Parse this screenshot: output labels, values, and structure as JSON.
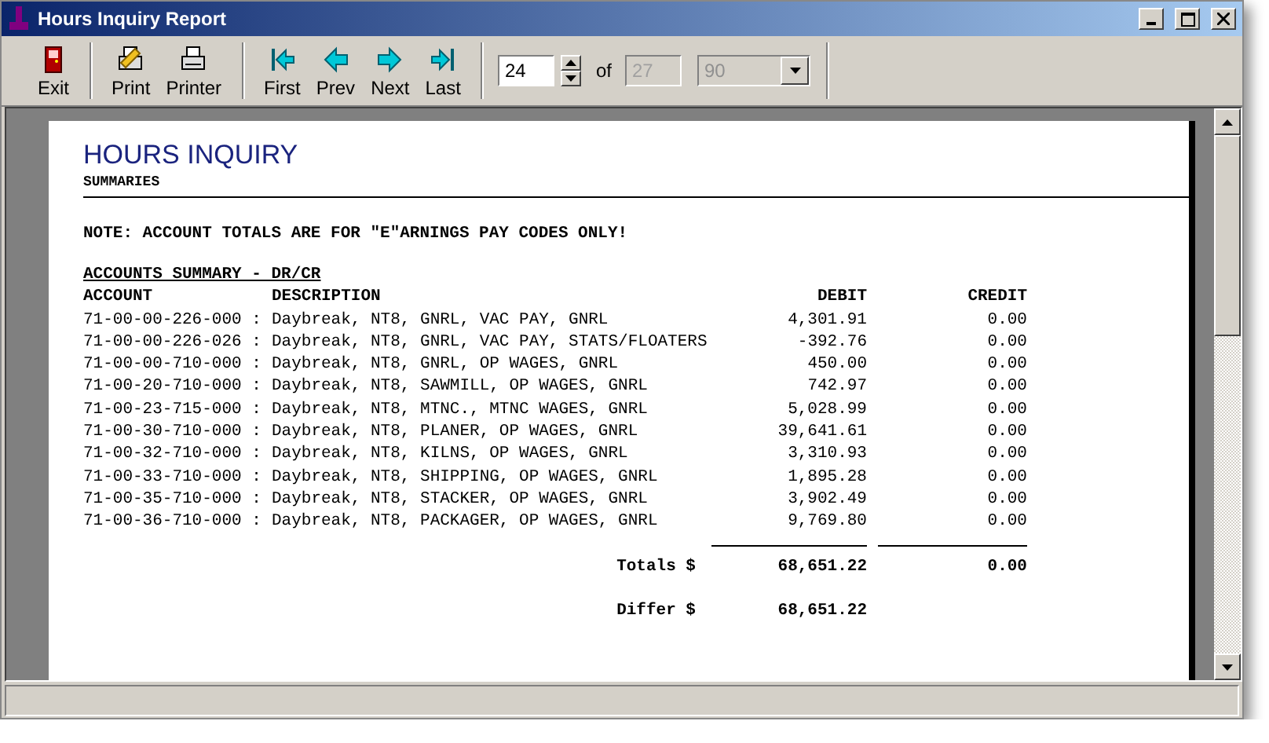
{
  "window": {
    "title": "Hours Inquiry Report"
  },
  "toolbar": {
    "groups": [
      [
        {
          "label": "Exit",
          "kind": "exit"
        }
      ],
      [
        {
          "label": "Print",
          "kind": "print"
        },
        {
          "label": "Printer",
          "kind": "printer"
        }
      ],
      [
        {
          "label": "First",
          "kind": "first"
        },
        {
          "label": "Prev",
          "kind": "prev"
        },
        {
          "label": "Next",
          "kind": "next"
        },
        {
          "label": "Last",
          "kind": "last"
        }
      ]
    ],
    "page_field": {
      "value": "24"
    },
    "of_label": "of",
    "total_field": {
      "value": "27",
      "disabled": true
    },
    "zoom_select": {
      "value": "90",
      "disabled": true
    }
  },
  "report": {
    "title": "HOURS INQUIRY",
    "subtitle": "SUMMARIES",
    "note": "NOTE: ACCOUNT TOTALS ARE FOR \"E\"ARNINGS PAY CODES ONLY!",
    "section": "ACCOUNTS SUMMARY - DR/CR",
    "columns": [
      "ACCOUNT",
      "DESCRIPTION",
      "DEBIT",
      "CREDIT"
    ],
    "rows": [
      {
        "account": "71-00-00-226-000 :",
        "description": "Daybreak, NT8, GNRL, VAC PAY, GNRL",
        "debit": "4,301.91",
        "credit": "0.00"
      },
      {
        "account": "71-00-00-226-026 :",
        "description": "Daybreak, NT8, GNRL, VAC PAY, STATS/FLOATERS",
        "debit": "-392.76",
        "credit": "0.00"
      },
      {
        "account": "71-00-00-710-000 :",
        "description": "Daybreak, NT8, GNRL, OP WAGES, GNRL",
        "debit": "450.00",
        "credit": "0.00"
      },
      {
        "account": "71-00-20-710-000 :",
        "description": "Daybreak, NT8, SAWMILL, OP WAGES, GNRL",
        "debit": "742.97",
        "credit": "0.00"
      },
      {
        "account": "71-00-23-715-000 :",
        "description": "Daybreak, NT8, MTNC., MTNC WAGES, GNRL",
        "debit": "5,028.99",
        "credit": "0.00"
      },
      {
        "account": "71-00-30-710-000 :",
        "description": "Daybreak, NT8, PLANER, OP WAGES, GNRL",
        "debit": "39,641.61",
        "credit": "0.00"
      },
      {
        "account": "71-00-32-710-000 :",
        "description": "Daybreak, NT8, KILNS, OP WAGES, GNRL",
        "debit": "3,310.93",
        "credit": "0.00"
      },
      {
        "account": "71-00-33-710-000 :",
        "description": "Daybreak, NT8, SHIPPING, OP WAGES, GNRL",
        "debit": "1,895.28",
        "credit": "0.00"
      },
      {
        "account": "71-00-35-710-000 :",
        "description": "Daybreak, NT8, STACKER, OP WAGES, GNRL",
        "debit": "3,902.49",
        "credit": "0.00"
      },
      {
        "account": "71-00-36-710-000 :",
        "description": "Daybreak, NT8, PACKAGER, OP WAGES, GNRL",
        "debit": "9,769.80",
        "credit": "0.00"
      }
    ],
    "totals": {
      "label": "Totals $",
      "debit": "68,651.22",
      "credit": "0.00"
    },
    "differ": {
      "label": "Differ $",
      "debit": "68,651.22"
    }
  }
}
